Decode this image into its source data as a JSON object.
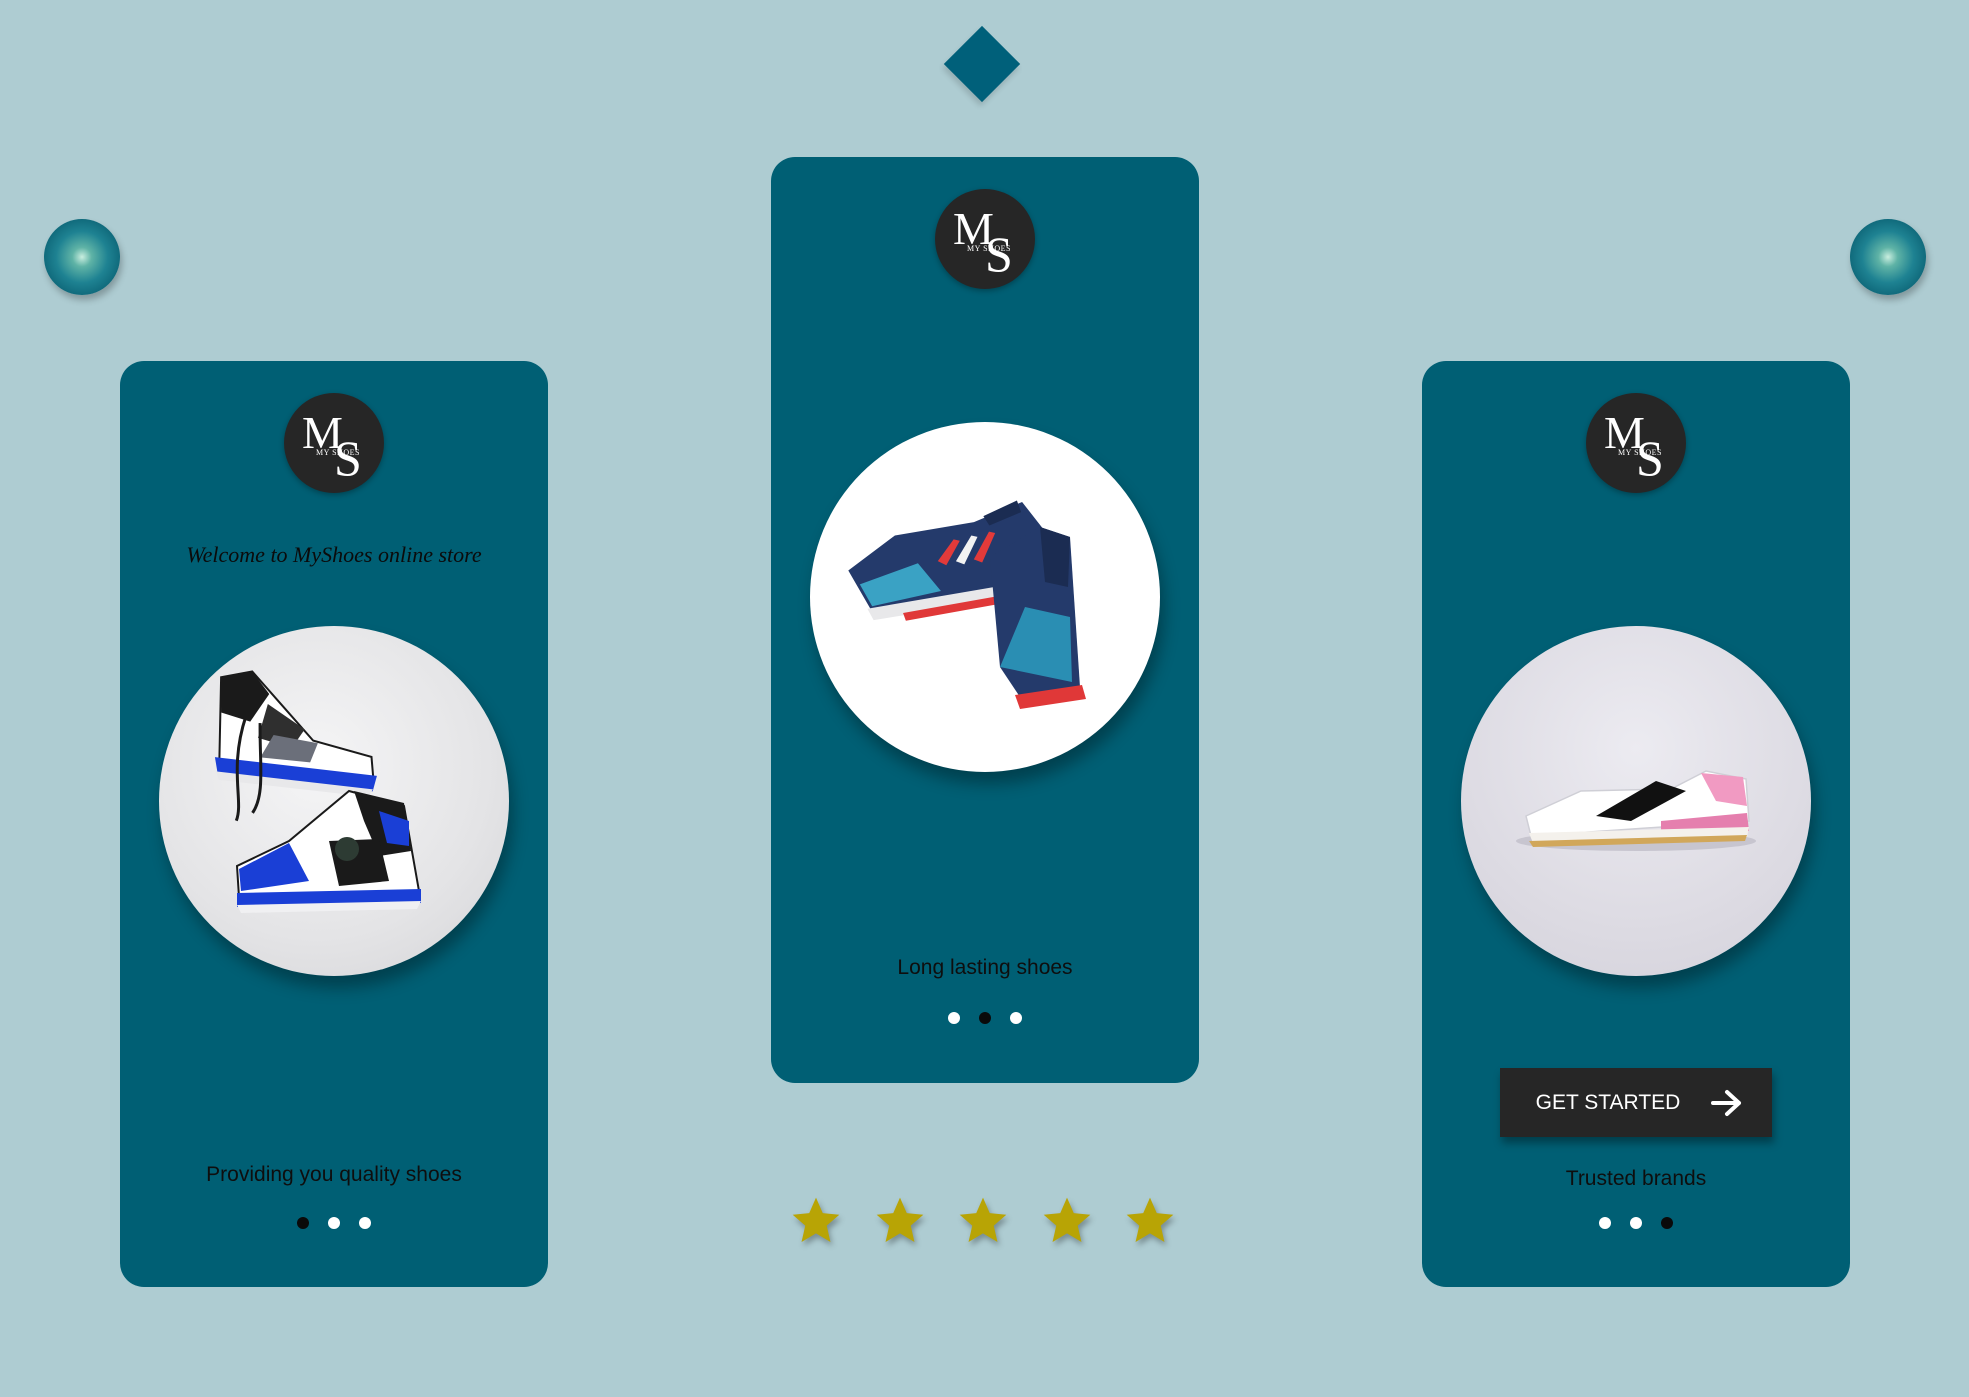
{
  "brand": {
    "logo_monogram": "MS",
    "logo_subtext": "MY SHOES",
    "logo_alt": "MyShoes logo"
  },
  "colors": {
    "background": "#aeccd2",
    "card": "#005f74",
    "button": "#262626",
    "star": "#b8a405",
    "dot_active": "#0a0a0a",
    "dot_inactive": "#ffffff"
  },
  "decorations": {
    "diamond_icon": "diamond-icon",
    "orb_icon": "glowing-orb-icon"
  },
  "screens": [
    {
      "welcome_text": "Welcome to MyShoes online store",
      "image": "high-top-sneakers-blue-black-white",
      "caption": "Providing you quality shoes",
      "active_dot": 1,
      "dot_count": 3
    },
    {
      "image": "running-shoes-navy-blue-red",
      "caption": "Long lasting shoes",
      "active_dot": 2,
      "dot_count": 3
    },
    {
      "image": "sneaker-white-pink-black",
      "button_label": "GET STARTED",
      "button_icon": "arrow-right-icon",
      "caption": "Trusted brands",
      "active_dot": 3,
      "dot_count": 3
    }
  ],
  "rating": {
    "stars": 5,
    "max": 5
  }
}
